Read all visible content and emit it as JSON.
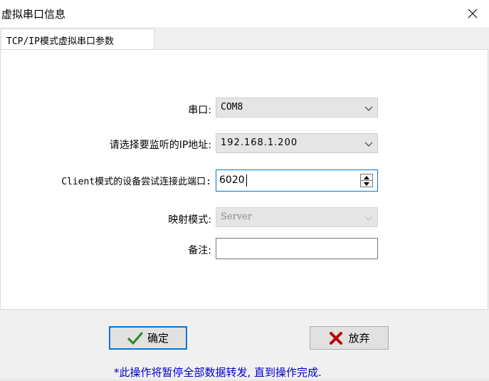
{
  "window": {
    "title": "虚拟串口信息"
  },
  "tab": {
    "label": "TCP/IP模式虚拟串口参数"
  },
  "form": {
    "serial_port": {
      "label": "串口:",
      "value": "COM8"
    },
    "listen_ip": {
      "label": "请选择要监听的IP地址:",
      "value": "192.168.1.200"
    },
    "client_port": {
      "label": "Client模式的设备尝试连接此端口:",
      "value": "6020"
    },
    "mapping_mode": {
      "label": "映射模式:",
      "value": "Server"
    },
    "remark": {
      "label": "备注:",
      "value": ""
    }
  },
  "buttons": {
    "ok_label": "确定",
    "cancel_label": "放弃"
  },
  "note": "*此操作将暂停全部数据转发, 直到操作完成.",
  "colors": {
    "accent": "#0078d7",
    "ok_check": "#2e8b2e",
    "cancel_x": "#c00000",
    "note_text": "#0000cc"
  }
}
